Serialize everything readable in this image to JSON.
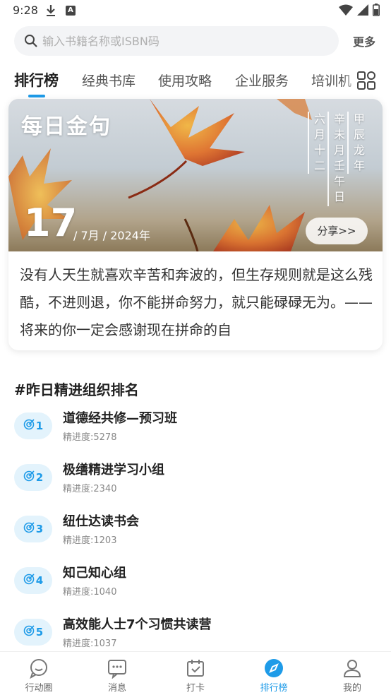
{
  "status_bar": {
    "time": "9:28",
    "icons": [
      "download-icon",
      "a-notification-icon",
      "wifi-icon",
      "signal-icon",
      "battery-icon"
    ]
  },
  "search": {
    "placeholder": "输入书籍名称或ISBN码",
    "more_label": "更多"
  },
  "tabs": [
    {
      "label": "排行榜",
      "active": true
    },
    {
      "label": "经典书库",
      "active": false
    },
    {
      "label": "使用攻略",
      "active": false
    },
    {
      "label": "企业服务",
      "active": false
    },
    {
      "label": "培训机",
      "active": false
    }
  ],
  "daily_quote": {
    "title": "每日金句",
    "lunar": [
      "甲辰龙年",
      "辛未月壬午日",
      "六月十二"
    ],
    "day": "17",
    "month_year": "/ 7月 / 2024年",
    "share_label": "分享>>",
    "quote": "没有人天生就喜欢辛苦和奔波的，但生存规则就是这么残酷，不进则退，你不能拼命努力，就只能碌碌无为。——将来的你一定会感谢现在拼命的自"
  },
  "ranking": {
    "title": "#昨日精进组织排名",
    "items": [
      {
        "rank": "1",
        "name": "道德经共修—预习班",
        "score": "精进度:5278"
      },
      {
        "rank": "2",
        "name": "极缮精进学习小组",
        "score": "精进度:2340"
      },
      {
        "rank": "3",
        "name": "纽仕达读书会",
        "score": "精进度:1203"
      },
      {
        "rank": "4",
        "name": "知己知心组",
        "score": "精进度:1040"
      },
      {
        "rank": "5",
        "name": "高效能人士7个习惯共读营",
        "score": "精进度:1037"
      }
    ]
  },
  "bottom_nav": [
    {
      "label": "行动圈",
      "icon": "chat-bubble-icon",
      "active": false
    },
    {
      "label": "消息",
      "icon": "message-icon",
      "active": false
    },
    {
      "label": "打卡",
      "icon": "calendar-check-icon",
      "active": false
    },
    {
      "label": "排行榜",
      "icon": "compass-icon",
      "active": true
    },
    {
      "label": "我的",
      "icon": "user-icon",
      "active": false
    }
  ],
  "colors": {
    "accent": "#1e9be8",
    "badge_bg": "#e3f3fc"
  }
}
